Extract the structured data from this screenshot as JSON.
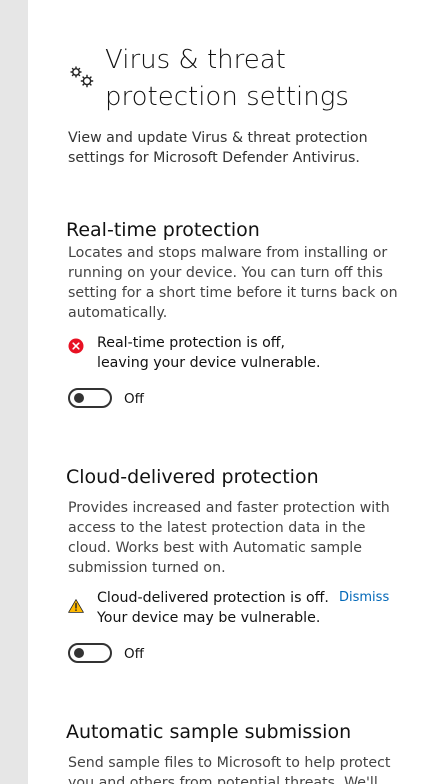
{
  "page": {
    "title": "Virus & threat protection settings",
    "intro": "View and update Virus & threat protection settings for Microsoft Defender Antivirus.",
    "header_icon": "gears-icon"
  },
  "sections": [
    {
      "title": "Real-time protection",
      "description": "Locates and stops malware from installing or running on your device. You can turn off this setting for a short time before it turns back on automatically.",
      "alert": {
        "icon": "error-icon",
        "color": "#e81123",
        "text": "Real-time protection is off, leaving your device vulnerable."
      },
      "toggle": {
        "state": "Off",
        "on": false
      }
    },
    {
      "title": "Cloud-delivered protection",
      "description": "Provides increased and faster protection with access to the latest protection data in the cloud. Works best with Automatic sample submission turned on.",
      "alert": {
        "icon": "warning-icon",
        "color": "#ffb900",
        "text": "Cloud-delivered protection is off. Your device may be vulnerable.",
        "action": "Dismiss"
      },
      "toggle": {
        "state": "Off",
        "on": false
      }
    },
    {
      "title": "Automatic sample submission",
      "description": "Send sample files to Microsoft to help protect you and others from potential threats. We'll"
    }
  ],
  "colors": {
    "accent": "#0067b8",
    "rail": "#e6e6e6"
  }
}
